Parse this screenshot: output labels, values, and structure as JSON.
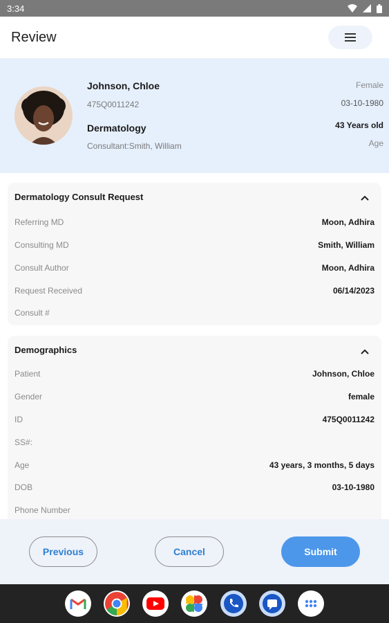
{
  "status_bar": {
    "time": "3:34"
  },
  "app_bar": {
    "title": "Review"
  },
  "patient": {
    "name": "Johnson, Chloe",
    "id": "475Q0011242",
    "department": "Dermatology",
    "consultant": "Consultant:Smith, William",
    "gender": "Female",
    "dob": "03-10-1980",
    "age": "43 Years old",
    "age_label": "Age"
  },
  "consult_section": {
    "title": "Dermatology Consult Request",
    "rows": [
      {
        "label": "Referring MD",
        "value": "Moon, Adhira"
      },
      {
        "label": "Consulting MD",
        "value": "Smith, William"
      },
      {
        "label": "Consult Author",
        "value": "Moon, Adhira"
      },
      {
        "label": "Request Received",
        "value": "06/14/2023"
      },
      {
        "label": "Consult #",
        "value": ""
      }
    ]
  },
  "demographics_section": {
    "title": "Demographics",
    "rows": [
      {
        "label": "Patient",
        "value": "Johnson, Chloe"
      },
      {
        "label": "Gender",
        "value": "female"
      },
      {
        "label": "ID",
        "value": "475Q0011242"
      },
      {
        "label": "SS#:",
        "value": ""
      },
      {
        "label": "Age",
        "value": "43 years, 3 months, 5 days"
      },
      {
        "label": "DOB",
        "value": "03-10-1980"
      },
      {
        "label": "Phone Number",
        "value": ""
      }
    ]
  },
  "actions": {
    "previous": "Previous",
    "cancel": "Cancel",
    "submit": "Submit"
  },
  "dock": [
    "gmail-icon",
    "chrome-icon",
    "youtube-icon",
    "photos-icon",
    "phone-icon",
    "messages-icon",
    "apps-icon"
  ],
  "colors": {
    "accent": "#4c97ea",
    "header_bg": "#e6f0fd",
    "link": "#2f7fd1"
  }
}
